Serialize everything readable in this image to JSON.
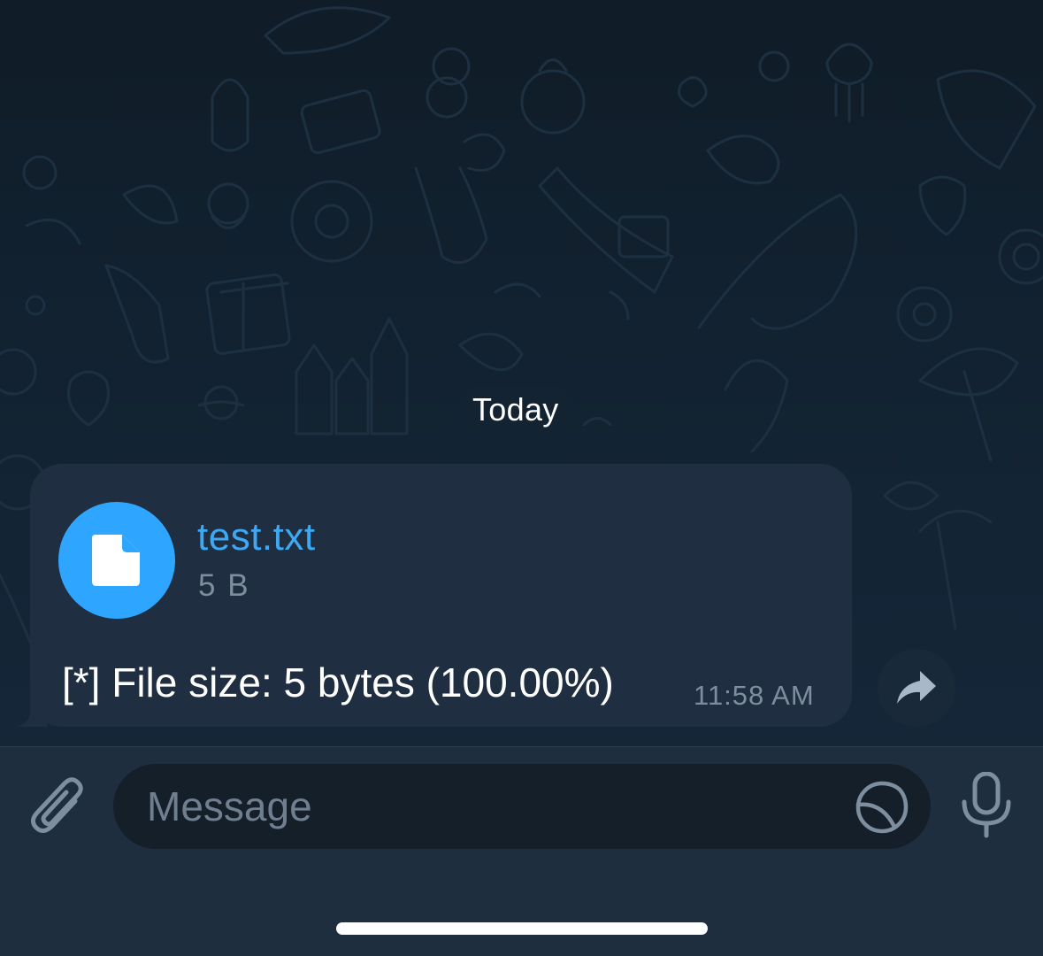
{
  "chat": {
    "date_label": "Today",
    "message": {
      "file_name": "test.txt",
      "file_size": "5 B",
      "text": "[*] File size: 5 bytes (100.00%)",
      "time": "11:58 AM"
    }
  },
  "composer": {
    "placeholder": "Message"
  },
  "icons": {
    "file": "file-icon",
    "share": "share-arrow-icon",
    "attach": "paperclip-icon",
    "sticker": "sticker-icon",
    "mic": "microphone-icon"
  },
  "colors": {
    "accent": "#2ea6ff",
    "bubble": "#1f2e40",
    "input_bar": "#1f2e3f",
    "muted_text": "#7d8e9f"
  }
}
